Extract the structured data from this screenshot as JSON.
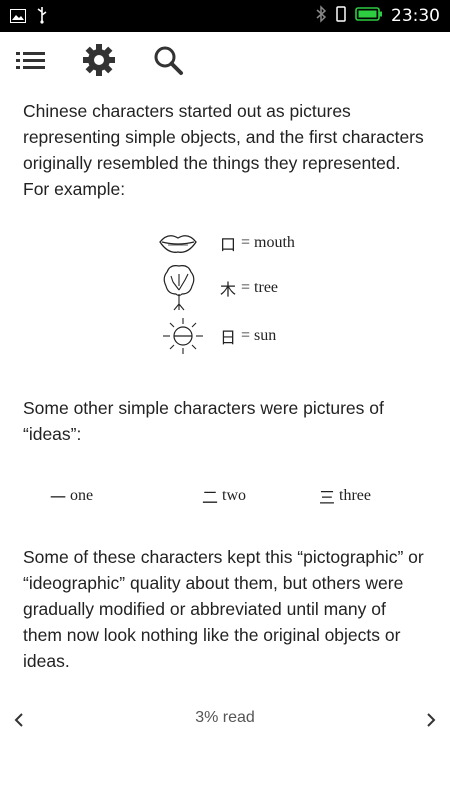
{
  "status_bar": {
    "time": "23:30",
    "icons": [
      "image-icon",
      "usb-icon",
      "bluetooth-icon",
      "vibrate-icon",
      "battery-icon"
    ]
  },
  "toolbar": {
    "icons": [
      "toc-list-icon",
      "settings-gear-icon",
      "search-icon"
    ]
  },
  "content": {
    "paragraph1": "Chinese characters started out as pictures representing simple objects, and the first characters originally resembled the things they represented. For example:",
    "pictographs": [
      {
        "character": "口",
        "meaning": "= mouth"
      },
      {
        "character": "木",
        "meaning": "= tree"
      },
      {
        "character": "日",
        "meaning": "= sun"
      }
    ],
    "paragraph2": "Some other simple characters were pictures of “ideas”:",
    "ideographs": [
      {
        "character": "一",
        "meaning": "one"
      },
      {
        "character": "二",
        "meaning": "two"
      },
      {
        "character": "三",
        "meaning": "three"
      }
    ],
    "paragraph3": "Some of these characters kept this “pictographic” or “ideographic” quality about them, but others were gradually modified or abbreviated until many of them now look nothing like the original objects or ideas."
  },
  "footer": {
    "progress_text": "3% read",
    "prev_icon": "chevron-left-icon",
    "next_icon": "chevron-right-icon"
  }
}
